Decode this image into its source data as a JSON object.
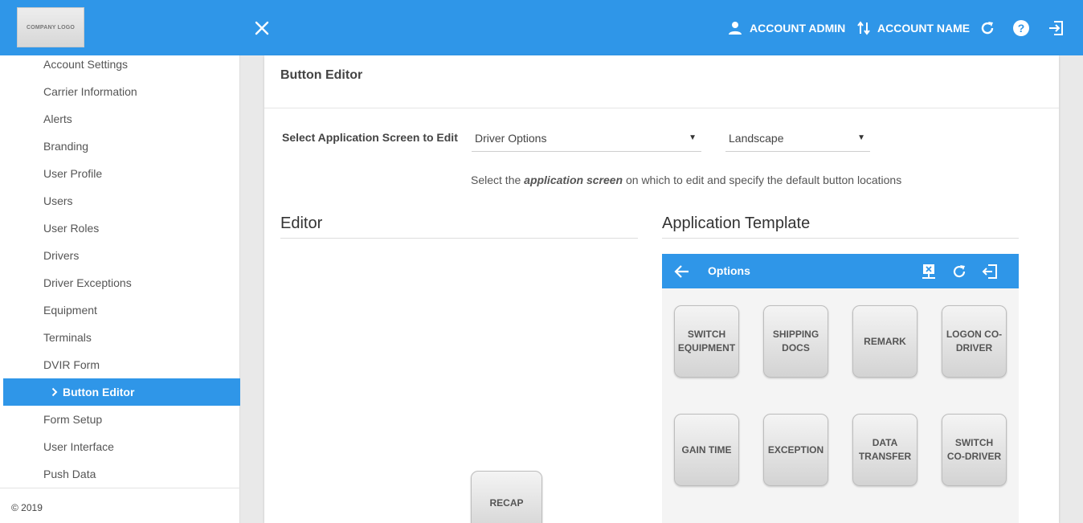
{
  "header": {
    "logo_text": "COMPANY LOGO",
    "account_admin": "ACCOUNT ADMIN",
    "account_name": "ACCOUNT NAME",
    "bg_color": "#2f96e8"
  },
  "sidebar": {
    "items": [
      {
        "label": "Account Settings"
      },
      {
        "label": "Carrier Information"
      },
      {
        "label": "Alerts"
      },
      {
        "label": "Branding"
      },
      {
        "label": "User Profile"
      },
      {
        "label": "Users"
      },
      {
        "label": "User Roles"
      },
      {
        "label": "Drivers"
      },
      {
        "label": "Driver Exceptions"
      },
      {
        "label": "Equipment"
      },
      {
        "label": "Terminals"
      },
      {
        "label": "DVIR Form"
      },
      {
        "label": "Button Editor",
        "active": true
      },
      {
        "label": "Form Setup"
      },
      {
        "label": "User Interface"
      },
      {
        "label": "Push Data"
      }
    ],
    "footer": "© 2019"
  },
  "main": {
    "title": "Button Editor",
    "select_label": "Select Application Screen to Edit",
    "screen_select": "Driver Options",
    "orientation_select": "Landscape",
    "hint_prefix": "Select the ",
    "hint_em": "application screen",
    "hint_suffix": " on which to edit and specify the default button locations",
    "editor_heading": "Editor",
    "template_heading": "Application Template",
    "editor_buttons": [
      {
        "label": "RECAP"
      }
    ]
  },
  "template": {
    "title": "Options",
    "buttons": [
      {
        "label": "SWITCH EQUIPMENT"
      },
      {
        "label": "SHIPPING DOCS"
      },
      {
        "label": "REMARK"
      },
      {
        "label": "LOGON CO-DRIVER"
      },
      {
        "label": "GAIN TIME"
      },
      {
        "label": "EXCEPTION"
      },
      {
        "label": "DATA TRANSFER"
      },
      {
        "label": "SWITCH CO-DRIVER"
      }
    ]
  }
}
